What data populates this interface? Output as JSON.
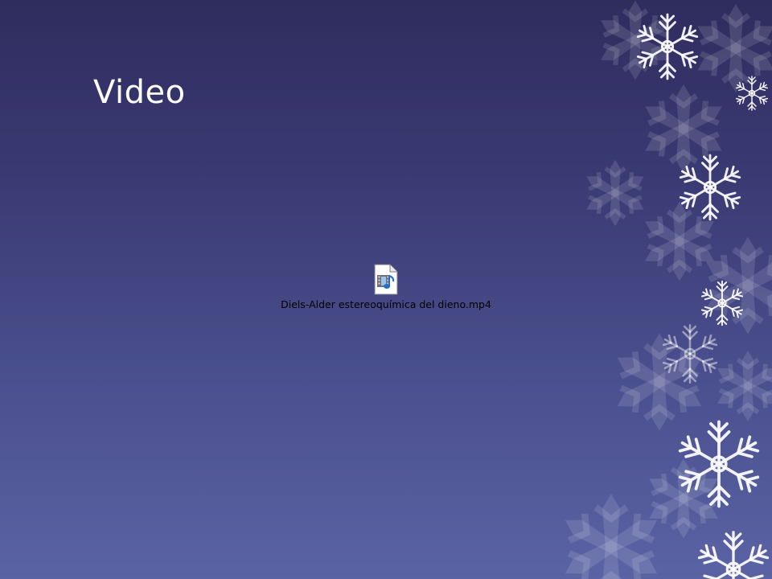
{
  "slide": {
    "title": "Video",
    "background_top": "#2f2c5e",
    "background_bottom": "#5a63a4"
  },
  "media": {
    "filename": "Diels-Alder estereoquímica del dieno.mp4",
    "icon": "video-file-icon"
  },
  "decor": {
    "icon": "snowflake-icon",
    "color": "#ffffff"
  }
}
